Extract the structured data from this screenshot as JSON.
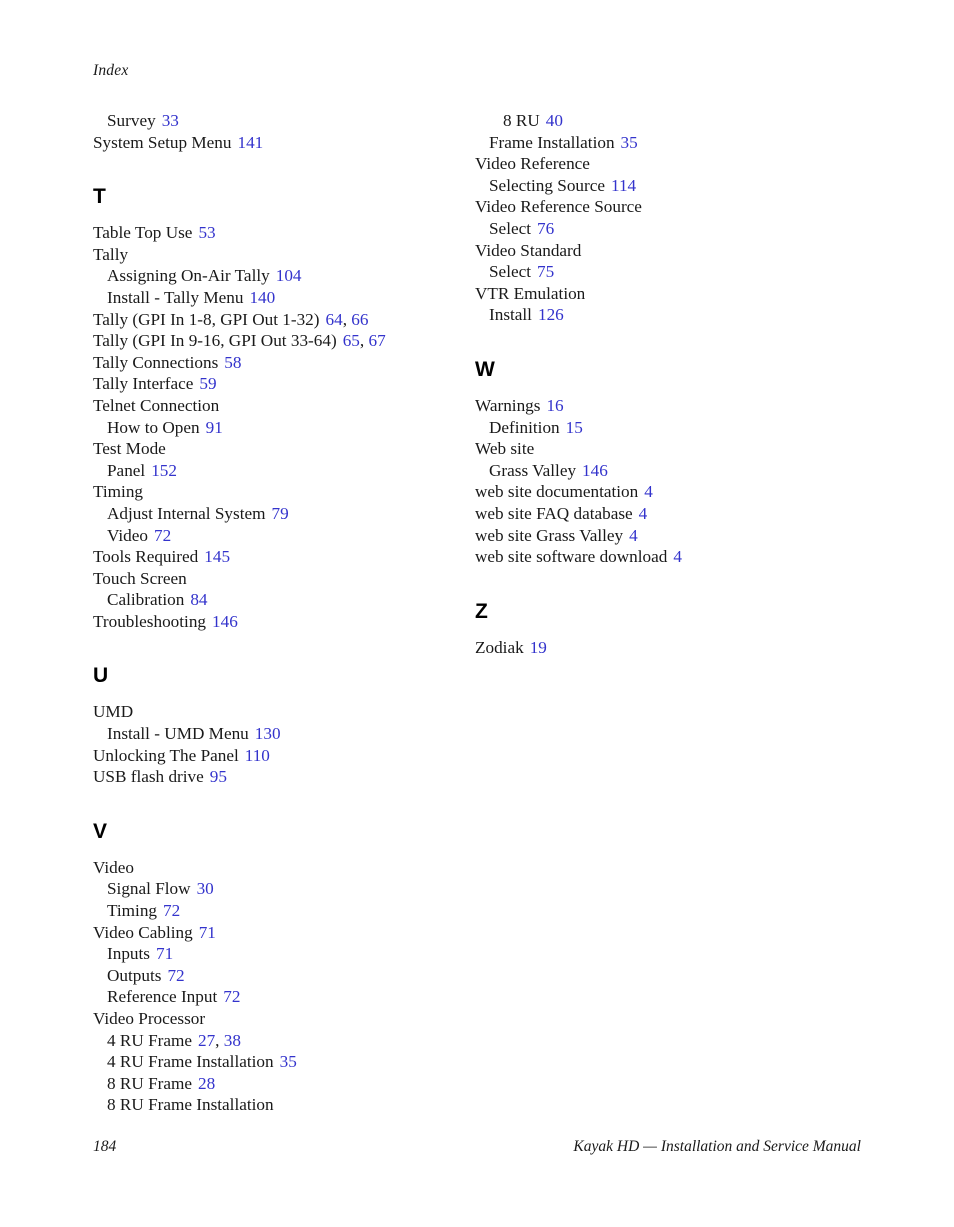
{
  "document": {
    "running_head": "Index",
    "page_number": "184",
    "footer_title": "Kayak HD  —  Installation and Service Manual",
    "page_number_color": "#3333cc",
    "text_color": "#1a1a1a"
  },
  "columns": [
    {
      "id": "left",
      "blocks": [
        {
          "type": "entries",
          "entries": [
            {
              "label": "Survey",
              "level": 2,
              "pages": [
                "33"
              ]
            },
            {
              "label": "System Setup Menu",
              "level": 1,
              "pages": [
                "141"
              ]
            }
          ]
        },
        {
          "type": "section",
          "letter": "T",
          "entries": [
            {
              "label": "Table Top Use",
              "level": 1,
              "pages": [
                "53"
              ]
            },
            {
              "label": "Tally",
              "level": 1,
              "pages": []
            },
            {
              "label": "Assigning On-Air Tally",
              "level": 2,
              "pages": [
                "104"
              ]
            },
            {
              "label": "Install - Tally Menu",
              "level": 2,
              "pages": [
                "140"
              ]
            },
            {
              "label": "Tally (GPI In 1-8, GPI Out 1-32)",
              "level": 1,
              "pages": [
                "64",
                "66"
              ]
            },
            {
              "label": "Tally (GPI In 9-16, GPI Out 33-64)",
              "level": 1,
              "pages": [
                "65",
                "67"
              ]
            },
            {
              "label": "Tally Connections",
              "level": 1,
              "pages": [
                "58"
              ]
            },
            {
              "label": "Tally Interface",
              "level": 1,
              "pages": [
                "59"
              ]
            },
            {
              "label": "Telnet Connection",
              "level": 1,
              "pages": []
            },
            {
              "label": "How to Open",
              "level": 2,
              "pages": [
                "91"
              ]
            },
            {
              "label": "Test Mode",
              "level": 1,
              "pages": []
            },
            {
              "label": "Panel",
              "level": 2,
              "pages": [
                "152"
              ]
            },
            {
              "label": "Timing",
              "level": 1,
              "pages": []
            },
            {
              "label": "Adjust Internal System",
              "level": 2,
              "pages": [
                "79"
              ]
            },
            {
              "label": "Video",
              "level": 2,
              "pages": [
                "72"
              ]
            },
            {
              "label": "Tools Required",
              "level": 1,
              "pages": [
                "145"
              ]
            },
            {
              "label": "Touch Screen",
              "level": 1,
              "pages": []
            },
            {
              "label": "Calibration",
              "level": 2,
              "pages": [
                "84"
              ]
            },
            {
              "label": "Troubleshooting",
              "level": 1,
              "pages": [
                "146"
              ]
            }
          ]
        },
        {
          "type": "section",
          "letter": "U",
          "entries": [
            {
              "label": "UMD",
              "level": 1,
              "pages": []
            },
            {
              "label": "Install - UMD Menu",
              "level": 2,
              "pages": [
                "130"
              ]
            },
            {
              "label": "Unlocking The Panel",
              "level": 1,
              "pages": [
                "110"
              ]
            },
            {
              "label": "USB flash drive",
              "level": 1,
              "pages": [
                "95"
              ]
            }
          ]
        },
        {
          "type": "section",
          "letter": "V",
          "entries": [
            {
              "label": "Video",
              "level": 1,
              "pages": []
            },
            {
              "label": "Signal Flow",
              "level": 2,
              "pages": [
                "30"
              ]
            },
            {
              "label": "Timing",
              "level": 2,
              "pages": [
                "72"
              ]
            },
            {
              "label": "Video Cabling",
              "level": 1,
              "pages": [
                "71"
              ]
            },
            {
              "label": "Inputs",
              "level": 2,
              "pages": [
                "71"
              ]
            },
            {
              "label": "Outputs",
              "level": 2,
              "pages": [
                "72"
              ]
            },
            {
              "label": "Reference Input",
              "level": 2,
              "pages": [
                "72"
              ]
            },
            {
              "label": "Video Processor",
              "level": 1,
              "pages": []
            },
            {
              "label": "4 RU Frame",
              "level": 2,
              "pages": [
                "27",
                "38"
              ]
            },
            {
              "label": "4 RU Frame Installation",
              "level": 2,
              "pages": [
                "35"
              ]
            },
            {
              "label": "8 RU Frame",
              "level": 2,
              "pages": [
                "28"
              ]
            },
            {
              "label": "8 RU Frame Installation",
              "level": 2,
              "pages": []
            }
          ]
        }
      ]
    },
    {
      "id": "right",
      "blocks": [
        {
          "type": "entries",
          "entries": [
            {
              "label": "8 RU",
              "level": 3,
              "pages": [
                "40"
              ]
            },
            {
              "label": "Frame Installation",
              "level": 2,
              "pages": [
                "35"
              ]
            },
            {
              "label": "Video Reference",
              "level": 1,
              "pages": []
            },
            {
              "label": "Selecting Source",
              "level": 2,
              "pages": [
                "114"
              ]
            },
            {
              "label": "Video Reference Source",
              "level": 1,
              "pages": []
            },
            {
              "label": "Select",
              "level": 2,
              "pages": [
                "76"
              ]
            },
            {
              "label": "Video Standard",
              "level": 1,
              "pages": []
            },
            {
              "label": "Select",
              "level": 2,
              "pages": [
                "75"
              ]
            },
            {
              "label": "VTR Emulation",
              "level": 1,
              "pages": []
            },
            {
              "label": "Install",
              "level": 2,
              "pages": [
                "126"
              ]
            }
          ]
        },
        {
          "type": "section",
          "letter": "W",
          "entries": [
            {
              "label": "Warnings",
              "level": 1,
              "pages": [
                "16"
              ]
            },
            {
              "label": "Definition",
              "level": 2,
              "pages": [
                "15"
              ]
            },
            {
              "label": "Web site",
              "level": 1,
              "pages": []
            },
            {
              "label": "Grass Valley",
              "level": 2,
              "pages": [
                "146"
              ]
            },
            {
              "label": "web site documentation",
              "level": 1,
              "pages": [
                "4"
              ]
            },
            {
              "label": "web site FAQ database",
              "level": 1,
              "pages": [
                "4"
              ]
            },
            {
              "label": "web site Grass Valley",
              "level": 1,
              "pages": [
                "4"
              ]
            },
            {
              "label": "web site software download",
              "level": 1,
              "pages": [
                "4"
              ]
            }
          ]
        },
        {
          "type": "section",
          "letter": "Z",
          "entries": [
            {
              "label": "Zodiak",
              "level": 1,
              "pages": [
                "19"
              ]
            }
          ]
        }
      ]
    }
  ]
}
